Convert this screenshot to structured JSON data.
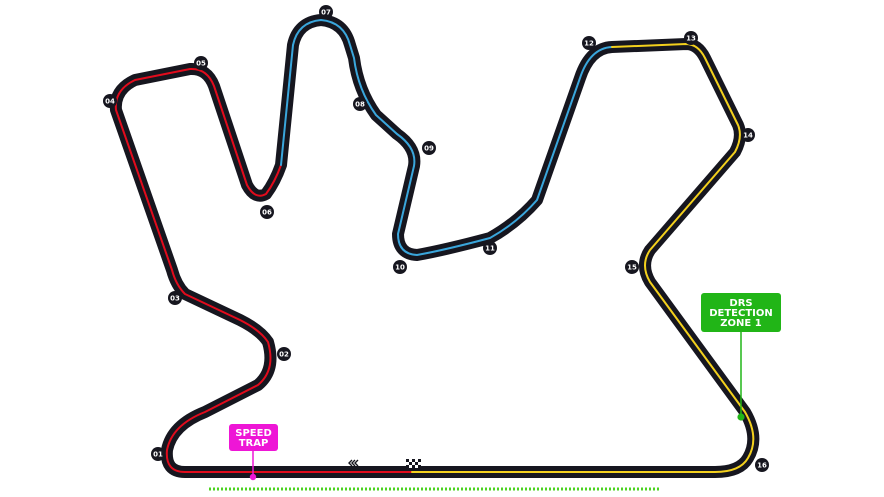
{
  "colors": {
    "track": "#16161f",
    "sector1": "#e10b1c",
    "sector2": "#3aa6dc",
    "sector3": "#f3d01d",
    "speed_trap": "#ee16d6",
    "drs": "#21b517",
    "drs_zone_line": "#4bd31f",
    "marker_text": "#ffffff"
  },
  "turns": [
    "01",
    "02",
    "03",
    "04",
    "05",
    "06",
    "07",
    "08",
    "09",
    "10",
    "11",
    "12",
    "13",
    "14",
    "15",
    "16"
  ],
  "speed_trap": {
    "line1": "SPEED",
    "line2": "TRAP"
  },
  "drs_detection": {
    "line1": "DRS",
    "line2": "DETECTION",
    "line3": "ZONE 1"
  },
  "icons": {
    "direction": "direction-chevrons-icon",
    "start_finish": "checkered-flag-icon"
  }
}
